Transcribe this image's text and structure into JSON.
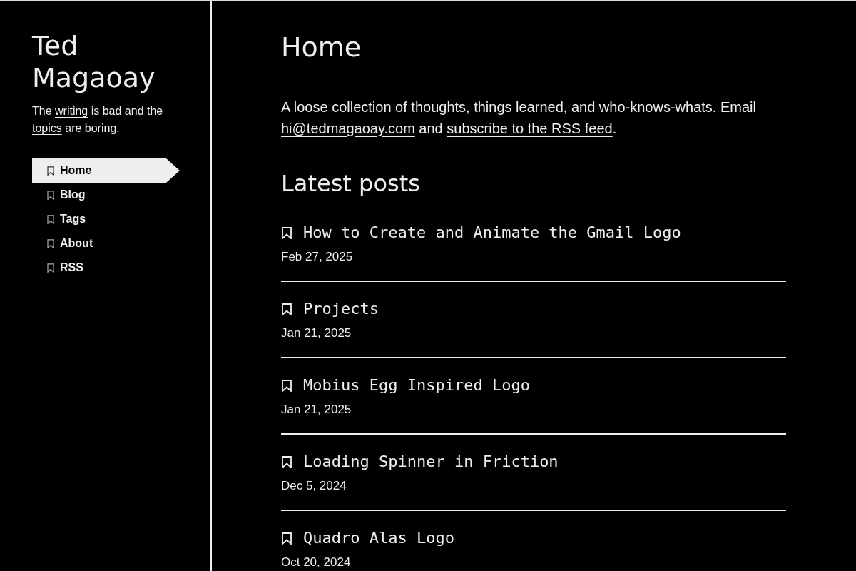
{
  "sidebar": {
    "site_title": "Ted Magaoay",
    "tagline": [
      {
        "kind": "text",
        "text": "The "
      },
      {
        "kind": "link",
        "text": "writing"
      },
      {
        "kind": "text",
        "text": " is bad and the "
      },
      {
        "kind": "link",
        "text": "topics"
      },
      {
        "kind": "text",
        "text": " are boring."
      }
    ],
    "nav": [
      {
        "label": "Home",
        "selected": true
      },
      {
        "label": "Blog",
        "selected": false
      },
      {
        "label": "Tags",
        "selected": false
      },
      {
        "label": "About",
        "selected": false
      },
      {
        "label": "RSS",
        "selected": false
      }
    ]
  },
  "main": {
    "page_title": "Home",
    "intro": [
      {
        "kind": "text",
        "text": "A loose collection of thoughts, things learned, and who-knows-whats. Email "
      },
      {
        "kind": "link",
        "text": "hi@tedmagaoay.com"
      },
      {
        "kind": "text",
        "text": " and "
      },
      {
        "kind": "link",
        "text": "subscribe to the RSS feed"
      },
      {
        "kind": "text",
        "text": "."
      }
    ],
    "section_title": "Latest posts",
    "posts": [
      {
        "title": "How to Create and Animate the Gmail Logo",
        "date": "Feb 27, 2025"
      },
      {
        "title": "Projects",
        "date": "Jan 21, 2025"
      },
      {
        "title": "Mobius Egg Inspired Logo",
        "date": "Jan 21, 2025"
      },
      {
        "title": "Loading Spinner in Friction",
        "date": "Dec 5, 2024"
      },
      {
        "title": "Quadro Alas Logo",
        "date": "Oct 20, 2024"
      }
    ]
  }
}
